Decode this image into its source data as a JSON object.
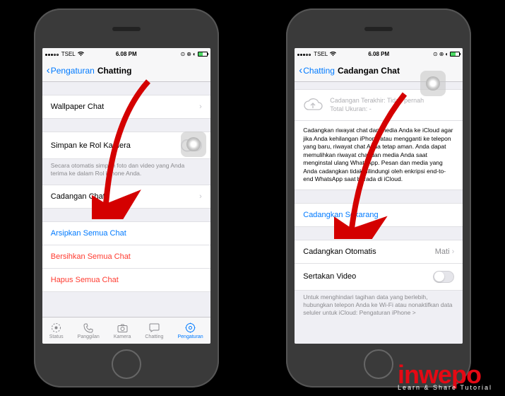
{
  "status": {
    "carrier": "TSEL",
    "time": "6.08 PM"
  },
  "phone1": {
    "nav_back": "Pengaturan",
    "nav_title": "Chatting",
    "row_wallpaper": "Wallpaper Chat",
    "row_save": "Simpan ke Rol Kamera",
    "footnote_save": "Secara otomatis simpan foto dan video yang Anda terima ke dalam Rol iPhone Anda.",
    "row_backup": "Cadangan Chat",
    "row_archive": "Arsipkan Semua Chat",
    "row_clear": "Bersihkan Semua Chat",
    "row_delete": "Hapus Semua Chat",
    "tabs": {
      "status": "Status",
      "calls": "Panggilan",
      "camera": "Kamera",
      "chats": "Chatting",
      "settings": "Pengaturan"
    }
  },
  "phone2": {
    "nav_back": "Chatting",
    "nav_title": "Cadangan Chat",
    "cloud_last": "Cadangan Terakhir: Tidak pernah",
    "cloud_size": "Total Ukuran: -",
    "desc": "Cadangkan riwayat chat dan media Anda ke iCloud agar jika Anda kehilangan iPhone atau mengganti ke telepon yang baru, riwayat chat Anda tetap aman. Anda dapat memulihkan riwayat chat dan media Anda saat menginstal ulang WhatsApp. Pesan dan media yang Anda cadangkan tidak dilindungi oleh enkripsi end-to-end WhatsApp saat berada di iCloud.",
    "row_backup_now": "Cadangkan Sekarang",
    "row_auto": "Cadangkan Otomatis",
    "row_auto_value": "Mati",
    "row_video": "Sertakan Video",
    "footnote_wifi": "Untuk menghindari tagihan data yang berlebih, hubungkan telepon Anda ke Wi-Fi atau nonaktifkan data seluler untuk iCloud: Pengaturan iPhone >"
  },
  "watermark": {
    "name": "inwepo",
    "tagline": "Learn & Share Tutorial"
  }
}
